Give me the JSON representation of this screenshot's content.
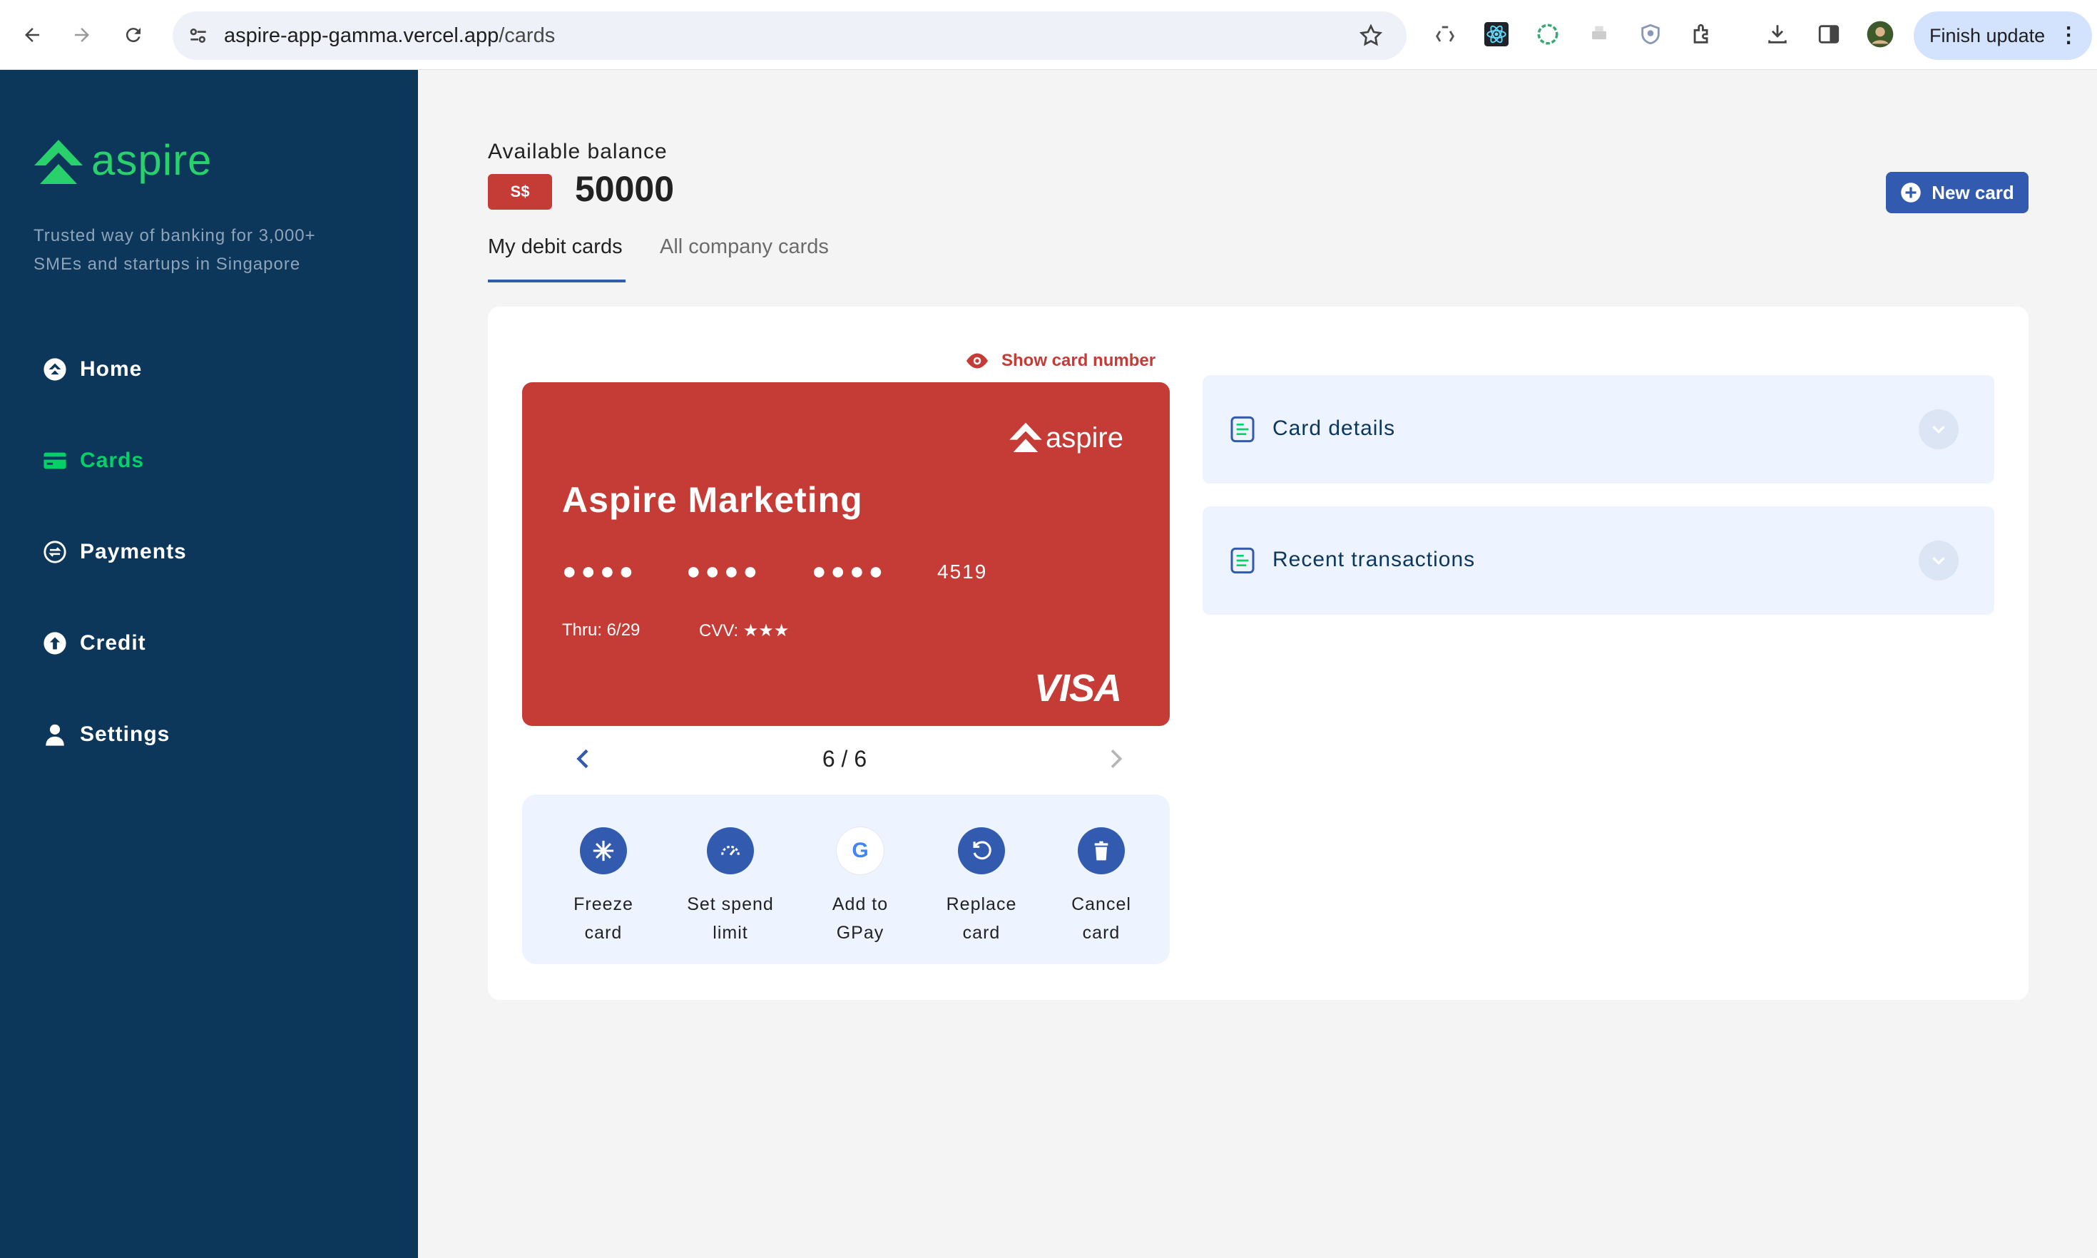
{
  "browser": {
    "url_host": "aspire-app-gamma.vercel.app",
    "url_path": "/cards",
    "finish_update_label": "Finish update"
  },
  "sidebar": {
    "logo_text": "aspire",
    "tagline": "Trusted way of banking for 3,000+ SMEs and startups in Singapore",
    "items": [
      {
        "label": "Home",
        "icon": "home-icon",
        "active": false
      },
      {
        "label": "Cards",
        "icon": "card-icon",
        "active": true
      },
      {
        "label": "Payments",
        "icon": "payments-icon",
        "active": false
      },
      {
        "label": "Credit",
        "icon": "credit-icon",
        "active": false
      },
      {
        "label": "Settings",
        "icon": "user-icon",
        "active": false
      }
    ],
    "active_color": "#01d167",
    "bg_color": "#0c365a"
  },
  "main": {
    "balance_label": "Available balance",
    "currency": "S$",
    "amount": "50000",
    "new_card_label": "New card",
    "tabs": [
      {
        "label": "My debit cards",
        "active": true
      },
      {
        "label": "All company cards",
        "active": false
      }
    ]
  },
  "card": {
    "show_number_label": "Show card number",
    "logo_text": "aspire",
    "name": "Aspire Marketing",
    "masked_groups": [
      "●●●●",
      "●●●●",
      "●●●●"
    ],
    "last4": "4519",
    "thru": "Thru: 6/29",
    "cvv": "CVV: ★★★",
    "brand": "VISA",
    "color": "#c53b35"
  },
  "pager": {
    "current": "6 / 6"
  },
  "actions": [
    {
      "label_line1": "Freeze",
      "label_line2": "card",
      "icon": "freeze-icon"
    },
    {
      "label_line1": "Set spend",
      "label_line2": "limit",
      "icon": "spend-limit-icon"
    },
    {
      "label_line1": "Add to",
      "label_line2": "GPay",
      "icon": "gpay-icon"
    },
    {
      "label_line1": "Replace",
      "label_line2": "card",
      "icon": "replace-icon"
    },
    {
      "label_line1": "Cancel",
      "label_line2": "card",
      "icon": "trash-icon"
    }
  ],
  "accordions": [
    {
      "title": "Card details"
    },
    {
      "title": "Recent transactions"
    }
  ]
}
